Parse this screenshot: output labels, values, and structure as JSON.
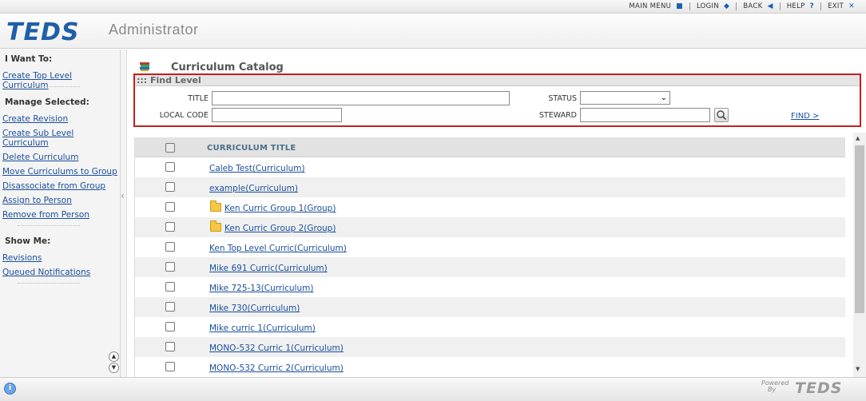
{
  "topnav": {
    "main_menu": "MAIN MENU",
    "login": "LOGIN",
    "back": "BACK",
    "help": "HELP",
    "exit": "EXIT"
  },
  "header": {
    "logo": "TEDS",
    "subtitle": "Administrator"
  },
  "sidebar": {
    "i_want_to": "I Want To:",
    "create_top": "Create Top Level Curriculum",
    "manage_selected": "Manage Selected:",
    "actions": [
      "Create Revision",
      "Create Sub Level Curriculum",
      "Delete Curriculum",
      "Move Curriculums to Group",
      "Disassociate from Group",
      "Assign to Person",
      "Remove from Person"
    ],
    "show_me": "Show Me:",
    "show_links": [
      "Revisions",
      "Queued Notifications"
    ]
  },
  "main": {
    "title": "Curriculum Catalog"
  },
  "find": {
    "header": "::: Find Level",
    "title_label": "TITLE",
    "title_value": "",
    "local_code_label": "LOCAL CODE",
    "local_code_value": "",
    "status_label": "STATUS",
    "status_value": "",
    "steward_label": "STEWARD",
    "steward_value": "",
    "find_link": "FIND >"
  },
  "table": {
    "column": "CURRICULUM TITLE",
    "rows": [
      {
        "label": "Caleb Test(Curriculum)",
        "folder": false
      },
      {
        "label": "example(Curriculum)",
        "folder": false
      },
      {
        "label": "Ken Curric Group 1(Group)",
        "folder": true
      },
      {
        "label": "Ken Curric Group 2(Group)",
        "folder": true
      },
      {
        "label": "Ken Top Level Curric(Curriculum)",
        "folder": false
      },
      {
        "label": "Mike 691 Curric(Curriculum)",
        "folder": false
      },
      {
        "label": "Mike 725-13(Curriculum)",
        "folder": false
      },
      {
        "label": "Mike 730(Curriculum)",
        "folder": false
      },
      {
        "label": "Mike curric 1(Curriculum)",
        "folder": false
      },
      {
        "label": "MONO-532 Curric 1(Curriculum)",
        "folder": false
      },
      {
        "label": "MONO-532 Curric 2(Curriculum)",
        "folder": false
      }
    ]
  },
  "footer": {
    "powered": "Powered",
    "by": "By",
    "logo": "TEDS",
    "info_icon": "i"
  },
  "colors": {
    "brand_blue": "#1f5fa8",
    "link": "#1a4f9c",
    "highlight_border": "#c41f1f"
  }
}
